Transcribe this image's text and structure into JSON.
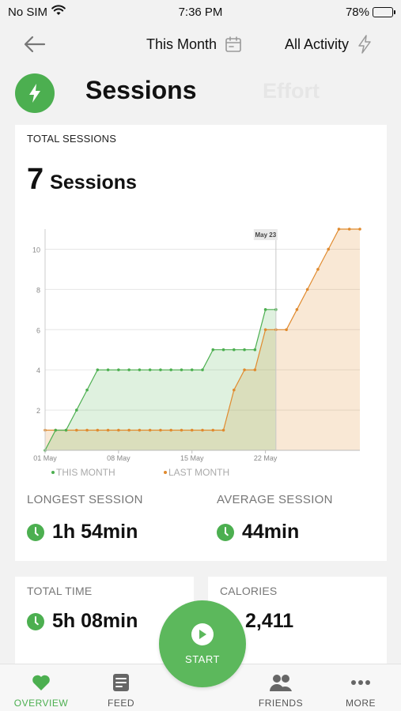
{
  "status_bar": {
    "carrier": "No SIM",
    "time": "7:36 PM",
    "battery_percent": "78%",
    "battery_level": 0.78,
    "wifi_icon": "wifi-icon"
  },
  "nav": {
    "back_icon": "arrow-left-icon",
    "period_label": "This Month",
    "activity_label": "All Activity"
  },
  "tabs": {
    "active": "Sessions",
    "inactive": "Effort"
  },
  "summary": {
    "label": "TOTAL SESSIONS",
    "value": "7",
    "unit": "Sessions"
  },
  "chart_data": {
    "type": "area",
    "x_tick_labels": [
      "01 May",
      "08 May",
      "15 May",
      "22 May"
    ],
    "x_ticks_day": [
      1,
      8,
      15,
      22
    ],
    "y_ticks": [
      0,
      2,
      4,
      6,
      8,
      10
    ],
    "xlim": [
      1,
      31
    ],
    "ylim": [
      0,
      11
    ],
    "marker_label": "May 23",
    "marker_day": 23,
    "grid": true,
    "legend_position": "bottom",
    "series": [
      {
        "name": "THIS MONTH",
        "color": "#4caf50",
        "x": [
          1,
          2,
          3,
          4,
          5,
          6,
          7,
          8,
          9,
          10,
          11,
          12,
          13,
          14,
          15,
          16,
          17,
          18,
          19,
          20,
          21,
          22,
          23
        ],
        "y": [
          0,
          1,
          1,
          2,
          3,
          4,
          4,
          4,
          4,
          4,
          4,
          4,
          4,
          4,
          4,
          4,
          5,
          5,
          5,
          5,
          5,
          7,
          7
        ]
      },
      {
        "name": "LAST MONTH",
        "color": "#e08a2e",
        "x": [
          1,
          2,
          3,
          4,
          5,
          6,
          7,
          8,
          9,
          10,
          11,
          12,
          13,
          14,
          15,
          16,
          17,
          18,
          19,
          20,
          21,
          22,
          23,
          24,
          25,
          26,
          27,
          28,
          29,
          30,
          31
        ],
        "y": [
          1,
          1,
          1,
          1,
          1,
          1,
          1,
          1,
          1,
          1,
          1,
          1,
          1,
          1,
          1,
          1,
          1,
          1,
          3,
          4,
          4,
          6,
          6,
          6,
          7,
          8,
          9,
          10,
          11,
          11,
          11
        ]
      }
    ]
  },
  "stats": {
    "longest_label": "LONGEST SESSION",
    "longest_value": "1h 54min",
    "average_label": "AVERAGE SESSION",
    "average_value": "44min",
    "total_time_label": "TOTAL TIME",
    "total_time_value": "5h 08min",
    "calories_label": "CALORIES",
    "calories_value": "2,411"
  },
  "start_button": {
    "label": "START"
  },
  "tab_bar": {
    "overview": "OVERVIEW",
    "feed": "FEED",
    "friends": "FRIENDS",
    "more": "MORE"
  },
  "colors": {
    "accent": "#4caf50",
    "last_month": "#e08a2e"
  }
}
